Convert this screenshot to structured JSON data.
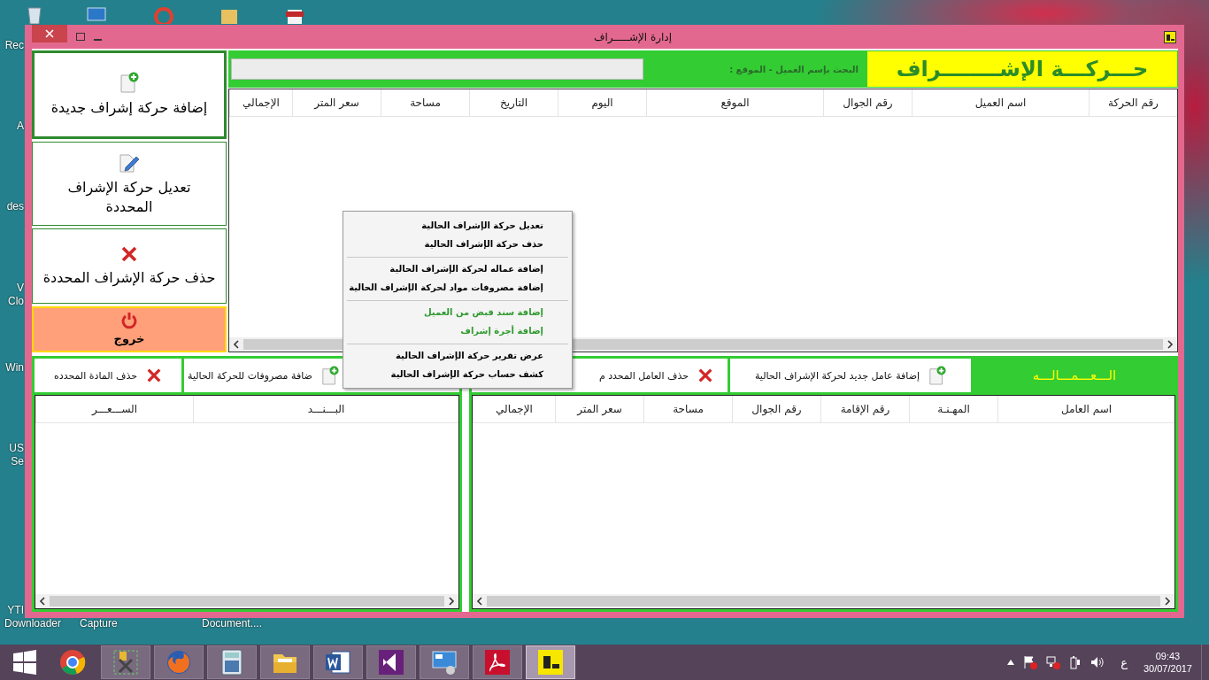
{
  "desktop": {
    "labels": [
      {
        "label": "Rec"
      },
      {
        "label": "A"
      },
      {
        "label": "des"
      },
      {
        "label": "V"
      },
      {
        "label": "Clo"
      },
      {
        "label": "Win"
      },
      {
        "label": "US"
      },
      {
        "label": "Se"
      },
      {
        "label": "YTI"
      },
      {
        "label": "Document...."
      },
      {
        "label": "Capture"
      },
      {
        "label": "Downloader"
      }
    ]
  },
  "window": {
    "title": "إدارة الإشـــــراف"
  },
  "actions": [
    {
      "label": "إضافة حركة إشراف جديدة",
      "kind": "add",
      "focused": true
    },
    {
      "label": "تعديل حركة الإشراف المحددة",
      "kind": "edit",
      "focused": false
    },
    {
      "label": "حذف حركة الإشراف المحددة",
      "kind": "delete",
      "focused": false
    },
    {
      "label": "خروج",
      "kind": "exit",
      "focused": false
    }
  ],
  "header": {
    "title": "حـــركـــة الإشــــــــراف",
    "search_label": "البحث بإسم العميل - الموقع :"
  },
  "movements_table": {
    "columns": [
      "رقم الحركة",
      "اسم العميل",
      "رقم الجوال",
      "الموقع",
      "اليوم",
      "التاريخ",
      "مساحة",
      "سعر المتر",
      "الإجمالي"
    ]
  },
  "expenses": {
    "buttons": [
      {
        "label": "ضافة مصروفات للحركة الحالية",
        "kind": "add"
      },
      {
        "label": "حذف المادة المحدده",
        "kind": "delete"
      }
    ],
    "columns": [
      "البـــنـــد",
      "الســـعـــر"
    ]
  },
  "workers": {
    "title": "الـــعـــمـــالـــه",
    "buttons": [
      {
        "label": "إضافة عامل جديد لحركة الإشراف الحالية",
        "kind": "add"
      },
      {
        "label": "حذف العامل المحدد م",
        "kind": "delete"
      }
    ],
    "columns": [
      "اسم العامل",
      "المهـنـة",
      "رقم الإقامة",
      "رقم الجوال",
      "مساحة",
      "سعر المتر",
      "الإجمالي"
    ]
  },
  "context_menu": {
    "groups": [
      {
        "items": [
          {
            "label": "تعديل حركة الإشراف الحالية",
            "color": "#000000"
          },
          {
            "label": "حذف حركة الإشراف الحالية",
            "color": "#000000"
          }
        ]
      },
      {
        "items": [
          {
            "label": "إضافة عماله لحركة الإشراف الحالية",
            "color": "#000000"
          },
          {
            "label": "إضافة مصروفات مواد لحركة الإشراف الحالية",
            "color": "#000000"
          }
        ]
      },
      {
        "items": [
          {
            "label": "إضافة سند قبض من العميل",
            "color": "#2e9a2e"
          },
          {
            "label": "إضافة أجرة إشراف",
            "color": "#2e9a2e"
          }
        ]
      },
      {
        "items": [
          {
            "label": "عرض تقرير حركة الإشراف الحالية",
            "color": "#000000"
          },
          {
            "label": "كشف حساب حركة الإشراف الحالية",
            "color": "#000000"
          }
        ]
      }
    ]
  },
  "taskbar": {
    "apps": [
      {
        "kind": "chrome",
        "running": false,
        "selected": false
      },
      {
        "kind": "tools",
        "running": true,
        "selected": false
      },
      {
        "kind": "firefox",
        "running": true,
        "selected": false
      },
      {
        "kind": "calculator",
        "running": true,
        "selected": false
      },
      {
        "kind": "explorer",
        "running": true,
        "selected": false
      },
      {
        "kind": "word",
        "running": true,
        "selected": false
      },
      {
        "kind": "studio",
        "running": true,
        "selected": false
      },
      {
        "kind": "remote",
        "running": true,
        "selected": false
      },
      {
        "kind": "acrobat",
        "running": true,
        "selected": false
      },
      {
        "kind": "app",
        "running": true,
        "selected": true
      }
    ],
    "tray": {
      "language": "ع",
      "time": "09:43",
      "date": "30/07/2017"
    }
  }
}
